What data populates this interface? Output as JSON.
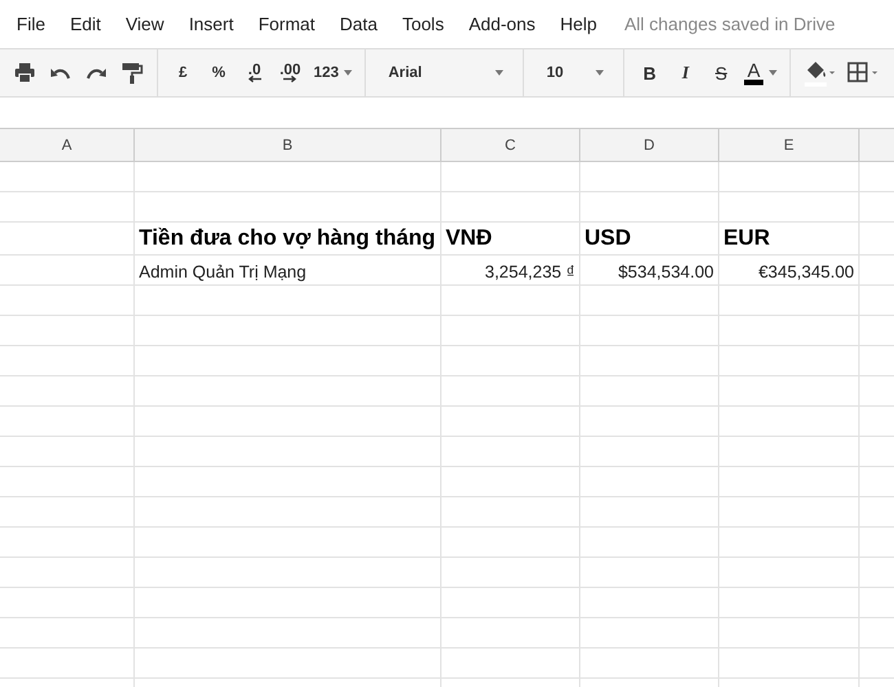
{
  "menu": [
    "File",
    "Edit",
    "View",
    "Insert",
    "Format",
    "Data",
    "Tools",
    "Add-ons",
    "Help"
  ],
  "save_status": "All changes saved in Drive",
  "toolbar": {
    "number_buttons": [
      "£",
      "%",
      ".0",
      ".00"
    ],
    "format_menu": "123",
    "font": "Arial",
    "font_size": "10",
    "style_buttons": [
      "B",
      "I",
      "S"
    ],
    "text_color_button": "A"
  },
  "columns": [
    "A",
    "B",
    "C",
    "D",
    "E"
  ],
  "rows": [
    {
      "kind": "heading",
      "cells": [
        null,
        {
          "text": "Tiền đưa cho vợ hàng tháng",
          "kind": "text"
        },
        {
          "text": "VNĐ",
          "kind": "text"
        },
        {
          "text": "USD",
          "kind": "text"
        },
        {
          "text": "EUR",
          "kind": "text"
        }
      ]
    },
    {
      "kind": "plain",
      "cells": [
        null,
        {
          "text": "Admin Quản Trị Mạng",
          "kind": "text"
        },
        {
          "text": "3,254,235 ₫",
          "kind": "number"
        },
        {
          "text": "$534,534.00",
          "kind": "number"
        },
        {
          "text": "€345,345.00",
          "kind": "number"
        }
      ]
    }
  ]
}
